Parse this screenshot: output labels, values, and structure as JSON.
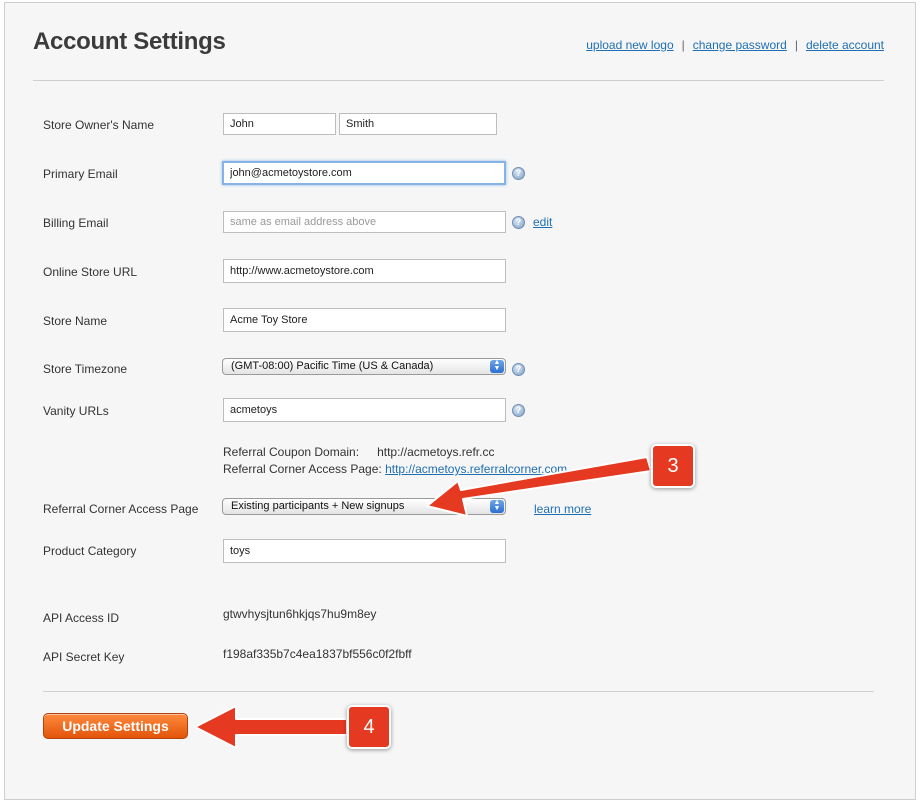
{
  "header": {
    "title": "Account Settings",
    "links": [
      "upload new logo",
      "change password",
      "delete account"
    ]
  },
  "form": {
    "owner_name_label": "Store Owner's Name",
    "first_name": "John",
    "last_name": "Smith",
    "primary_email_label": "Primary Email",
    "primary_email": "john@acmetoystore.com",
    "billing_email_label": "Billing Email",
    "billing_email_placeholder": "same as email address above",
    "billing_edit": "edit",
    "store_url_label": "Online Store URL",
    "store_url": "http://www.acmetoystore.com",
    "store_name_label": "Store Name",
    "store_name": "Acme Toy Store",
    "timezone_label": "Store Timezone",
    "timezone": "(GMT-08:00) Pacific Time (US & Canada)",
    "vanity_label": "Vanity URLs",
    "vanity": "acmetoys",
    "coupon_domain_label": "Referral Coupon Domain:",
    "coupon_domain": "http://acmetoys.refr.cc",
    "corner_page_label": "Referral Corner Access Page:",
    "corner_page_url": "http://acmetoys.referralcorner.com",
    "access_label": "Referral Corner Access Page",
    "access_value": "Existing participants + New signups",
    "learn_more": "learn more",
    "category_label": "Product Category",
    "category": "toys",
    "api_id_label": "API Access ID",
    "api_id": "gtwvhysjtun6hkjqs7hu9m8ey",
    "api_key_label": "API Secret Key",
    "api_key": "f198af335b7c4ea1837bf556c0f2fbff",
    "submit": "Update Settings"
  },
  "annotations": {
    "step3": "3",
    "step4": "4",
    "arrow_color": "#e53a21"
  },
  "icons": {
    "help": "question-circle-icon"
  }
}
